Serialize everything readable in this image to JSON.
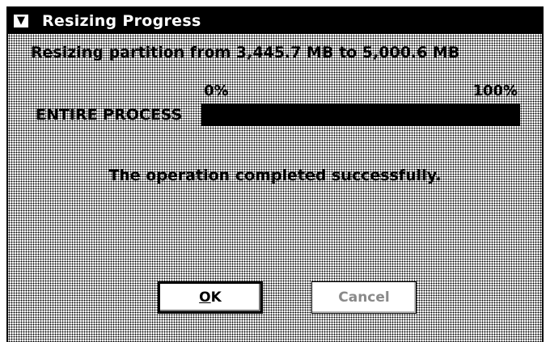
{
  "window": {
    "title": "Resizing Progress",
    "system_menu_icon": "system-menu-icon"
  },
  "dialog": {
    "message": "Resizing partition from 3,445.7 MB to 5,000.6 MB",
    "progress_start_label": "0%",
    "progress_end_label": "100%",
    "process_label": "ENTIRE PROCESS",
    "progress_value": 1.0,
    "status": "The operation completed successfully."
  },
  "buttons": {
    "ok_label_underlined": "O",
    "ok_label_rest": "K",
    "cancel_label": "Cancel",
    "cancel_enabled": false
  },
  "colors": {
    "titlebar": "#000000",
    "progress_fill": "#000000",
    "disabled_text": "#8a8a8a"
  }
}
